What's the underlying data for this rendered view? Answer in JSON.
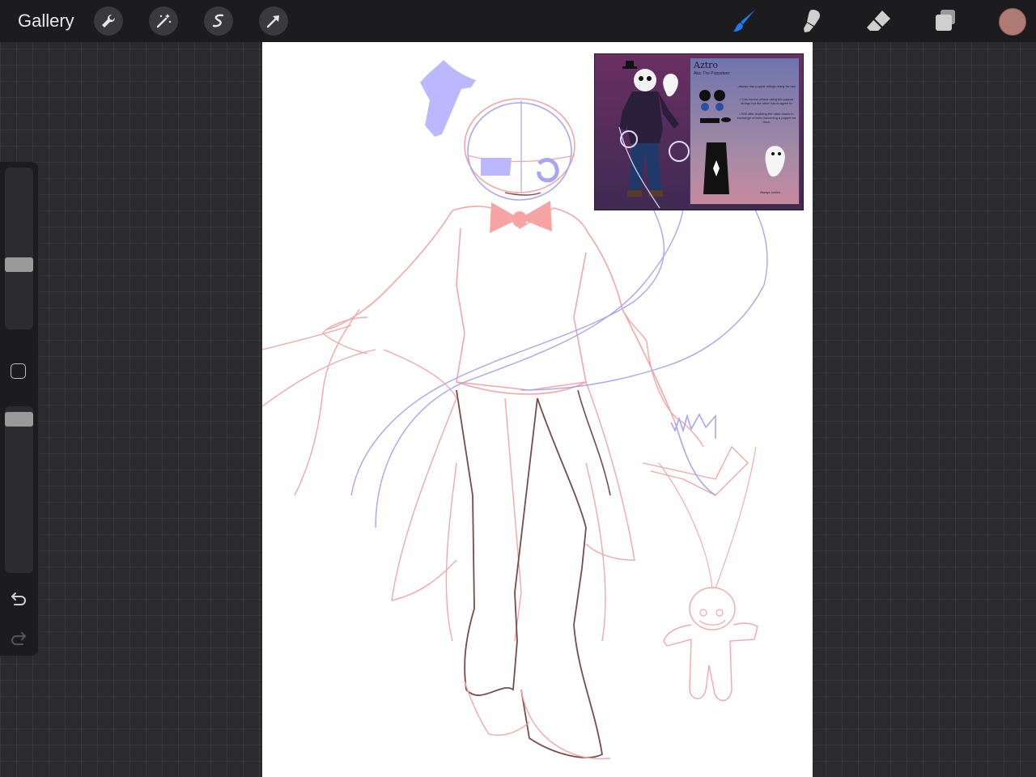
{
  "toolbar": {
    "gallery_label": "Gallery",
    "left_tools": [
      "wrench-icon",
      "magic-wand-icon",
      "selection-icon",
      "transform-arrow-icon"
    ],
    "right_tools": [
      "brush-icon",
      "smudge-icon",
      "eraser-icon",
      "layers-icon"
    ],
    "active_tool": "brush-icon",
    "accent_color": "#1d7bf2",
    "current_color": "#b07a74"
  },
  "sidebar": {
    "brush_size_level": 0.55,
    "opacity_level": 0.95,
    "buttons": [
      "modify-square-icon",
      "undo-icon",
      "redo-icon"
    ]
  },
  "reference": {
    "title": "Aztro",
    "subtitle": "Aka: The Puppeteer",
    "notes": [
      "-always has puppet strings ready for use",
      "• Can control others using the puppet strings but the other has to agree to",
      "• Will offer anything the other wants in exchange of them becoming a puppet for them"
    ],
    "caption": "Always smiles"
  },
  "colors": {
    "sketch_red": "#f2a8a8",
    "sketch_blue": "#a9a6f0",
    "sketch_dark": "#7a4a4a",
    "hat_fill": "#bcb8ff",
    "bowtie_fill": "#f7a3a3"
  }
}
